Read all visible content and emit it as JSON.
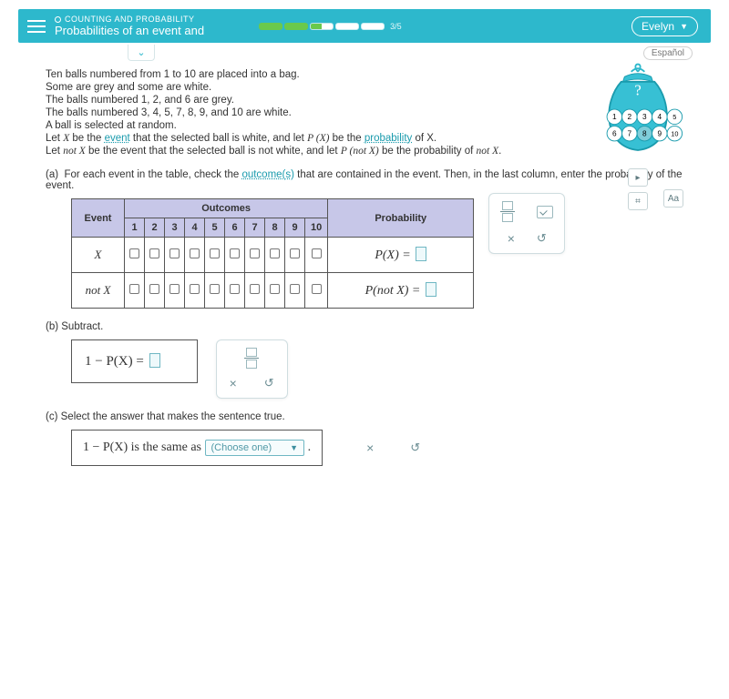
{
  "header": {
    "category": "COUNTING AND PROBABILITY",
    "title": "Probabilities of an event and",
    "progress_label": "3/5",
    "user": "Evelyn",
    "espanol": "Español"
  },
  "problem": {
    "p1": "Ten balls numbered from 1 to 10 are placed into a bag.",
    "p2": "Some are grey and some are white.",
    "p3": "The balls numbered 1, 2, and 6 are grey.",
    "p4": "The balls numbered 3, 4, 5, 7, 8, 9, and 10 are white.",
    "p5a": "A ball is selected at random.",
    "p5b_pre": "Let ",
    "p5b_X": "X",
    "p5b_mid": " be the ",
    "p5b_link1": "event",
    "p5b_mid2": " that the selected ball is white, and let ",
    "p5b_px": "P (X)",
    "p5b_mid3": " be the ",
    "p5b_link2": "probability",
    "p5b_end": " of X.",
    "p6a": "Let ",
    "p6_notx": "not X",
    "p6b": " be the event that the selected ball is not white, and let ",
    "p6_pnotx": "P (not X)",
    "p6c": " be the probability of ",
    "p6d": "not X",
    "p6e": "."
  },
  "bag_balls": [
    "1",
    "2",
    "3",
    "4",
    "5",
    "6",
    "7",
    "8",
    "9",
    "10"
  ],
  "part_a": {
    "label": "(a)",
    "text_pre": "For each event in the table, check the ",
    "link": "outcome(s)",
    "text_post": " that are contained in the event. Then, in the last column, enter the probability of the event.",
    "th_event": "Event",
    "th_outcomes": "Outcomes",
    "th_prob": "Probability",
    "cols": [
      "1",
      "2",
      "3",
      "4",
      "5",
      "6",
      "7",
      "8",
      "9",
      "10"
    ],
    "row1_event": "X",
    "row1_prob": "P(X) = ",
    "row2_event": "not X",
    "row2_prob": "P(not X) = "
  },
  "part_b": {
    "label": "(b)",
    "text": "Subtract.",
    "eq": "1 − P(X) = "
  },
  "part_c": {
    "label": "(c)",
    "text": "Select the answer that makes the sentence true.",
    "sentence_pre": "1 − P(X) is the same as ",
    "dd_placeholder": "(Choose one)"
  },
  "tools": {
    "close": "×",
    "reset": "↺"
  }
}
